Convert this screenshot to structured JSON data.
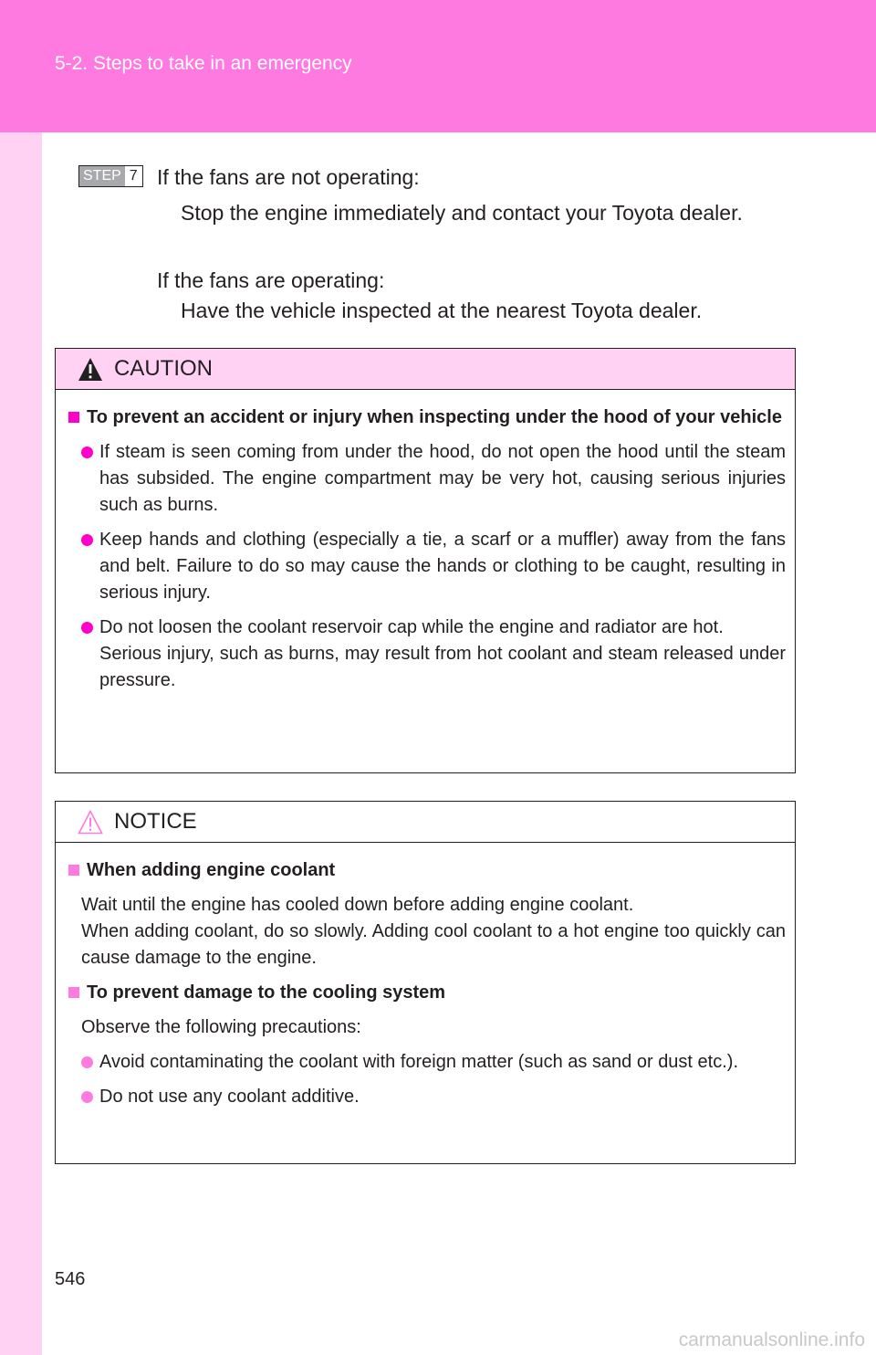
{
  "header": {
    "section_title": "5-2. Steps to take in an emergency"
  },
  "step": {
    "badge_label": "STEP",
    "badge_number": "7",
    "if_not_operating": "If the fans are not operating:",
    "not_operating_action": "Stop the engine immediately and contact your Toyota dealer.",
    "if_operating": "If the fans are operating:",
    "operating_action": "Have the vehicle inspected at the nearest Toyota dealer."
  },
  "caution": {
    "title": "CAUTION",
    "heading": "To prevent an accident or injury when inspecting under the hood of your vehicle",
    "bullets": [
      "If steam is seen coming from under the hood, do not open the hood until the steam has subsided. The engine compartment may be very hot, causing serious injuries such as burns.",
      "Keep hands and clothing (especially a tie, a scarf or a muffler) away from the fans and belt. Failure to do so may cause the hands or clothing to be caught, resulting in serious injury.",
      "Do not loosen the coolant reservoir cap while the engine and radiator are hot."
    ],
    "bullet3_continued": "Serious injury, such as burns, may result from hot coolant and steam released under pressure."
  },
  "notice": {
    "title": "NOTICE",
    "section1_heading": "When adding engine coolant",
    "section1_line1": "Wait until the engine has cooled down before adding engine coolant.",
    "section1_line2": "When adding coolant, do so slowly. Adding cool coolant to a hot engine too quickly can cause damage to the engine.",
    "section2_heading": "To prevent damage to the cooling system",
    "section2_intro": "Observe the following precautions:",
    "section2_bullets": [
      "Avoid contaminating the coolant with foreign matter (such as sand or dust etc.).",
      "Do not use any coolant additive."
    ]
  },
  "page_number": "546",
  "watermark": "carmanualsonline.info",
  "colors": {
    "header_band": "#ff7ae0",
    "side_band": "#ffd1f3",
    "accent": "#ff00cc"
  }
}
